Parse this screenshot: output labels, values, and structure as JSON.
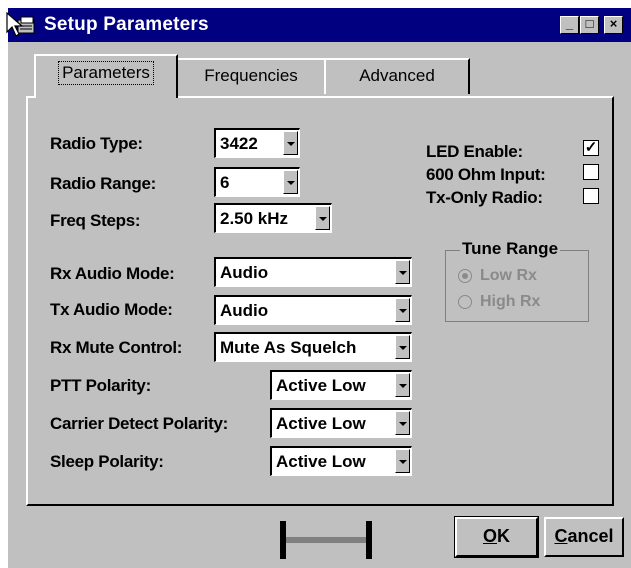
{
  "window": {
    "title": "Setup Parameters"
  },
  "title_buttons": [
    "minimize-icon",
    "maximize-icon",
    "close-icon"
  ],
  "tabs": [
    {
      "label": "Parameters",
      "active": true
    },
    {
      "label": "Frequencies",
      "active": false
    },
    {
      "label": "Advanced",
      "active": false
    }
  ],
  "fields": {
    "radio_type": {
      "label": "Radio Type:",
      "value": "3422"
    },
    "radio_range": {
      "label": "Radio Range:",
      "value": "6"
    },
    "freq_steps": {
      "label": "Freq Steps:",
      "value": "2.50 kHz"
    },
    "rx_audio_mode": {
      "label": "Rx Audio Mode:",
      "value": "Audio"
    },
    "tx_audio_mode": {
      "label": "Tx Audio Mode:",
      "value": "Audio"
    },
    "rx_mute_control": {
      "label": "Rx Mute Control:",
      "value": "Mute As Squelch"
    },
    "ptt_polarity": {
      "label": "PTT Polarity:",
      "value": "Active Low"
    },
    "carrier_detect_polarity": {
      "label": "Carrier Detect Polarity:",
      "value": "Active Low"
    },
    "sleep_polarity": {
      "label": "Sleep Polarity:",
      "value": "Active Low"
    }
  },
  "checkboxes": {
    "led_enable": {
      "label": "LED Enable:",
      "checked": true,
      "mark": "✓"
    },
    "ohm_input": {
      "label": "600 Ohm Input:",
      "checked": false,
      "mark": ""
    },
    "tx_only": {
      "label": "Tx-Only Radio:",
      "checked": false,
      "mark": ""
    }
  },
  "tune_range": {
    "title": "Tune Range",
    "options": [
      {
        "label": "Low Rx",
        "selected": true
      },
      {
        "label": "High Rx",
        "selected": false
      }
    ],
    "enabled": false
  },
  "buttons": {
    "ok": {
      "accel": "O",
      "rest": "K"
    },
    "cancel": {
      "accel": "C",
      "rest": "ancel"
    }
  },
  "colors": {
    "title_bar": "#000080",
    "face": "#c0c0c0",
    "disabled_text": "#8a8a8a"
  }
}
